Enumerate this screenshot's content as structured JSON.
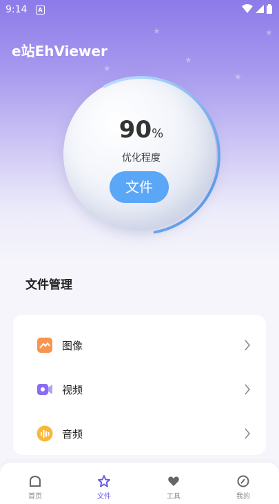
{
  "status_bar": {
    "time": "9:14",
    "a_icon": "A"
  },
  "app": {
    "title": "e站EhViewer"
  },
  "gauge": {
    "value": "90",
    "unit": "%",
    "label": "优化程度",
    "progress": 0.9,
    "button_label": "文件"
  },
  "section": {
    "title": "文件管理"
  },
  "file_items": [
    {
      "label": "图像",
      "icon": "image-icon",
      "color": "#f7944f"
    },
    {
      "label": "视频",
      "icon": "video-icon",
      "color": "#8a6cf0"
    },
    {
      "label": "音频",
      "icon": "audio-icon",
      "color": "#f7b93a"
    }
  ],
  "tabs": [
    {
      "label": "首页",
      "icon": "home-icon",
      "active": false
    },
    {
      "label": "文件",
      "icon": "star-icon",
      "active": true
    },
    {
      "label": "工具",
      "icon": "heart-icon",
      "active": false
    },
    {
      "label": "我的",
      "icon": "leaf-icon",
      "active": false
    }
  ],
  "colors": {
    "accent": "#6a5ae0",
    "button": "#5aa6f7",
    "ring": "#4a90e2"
  }
}
